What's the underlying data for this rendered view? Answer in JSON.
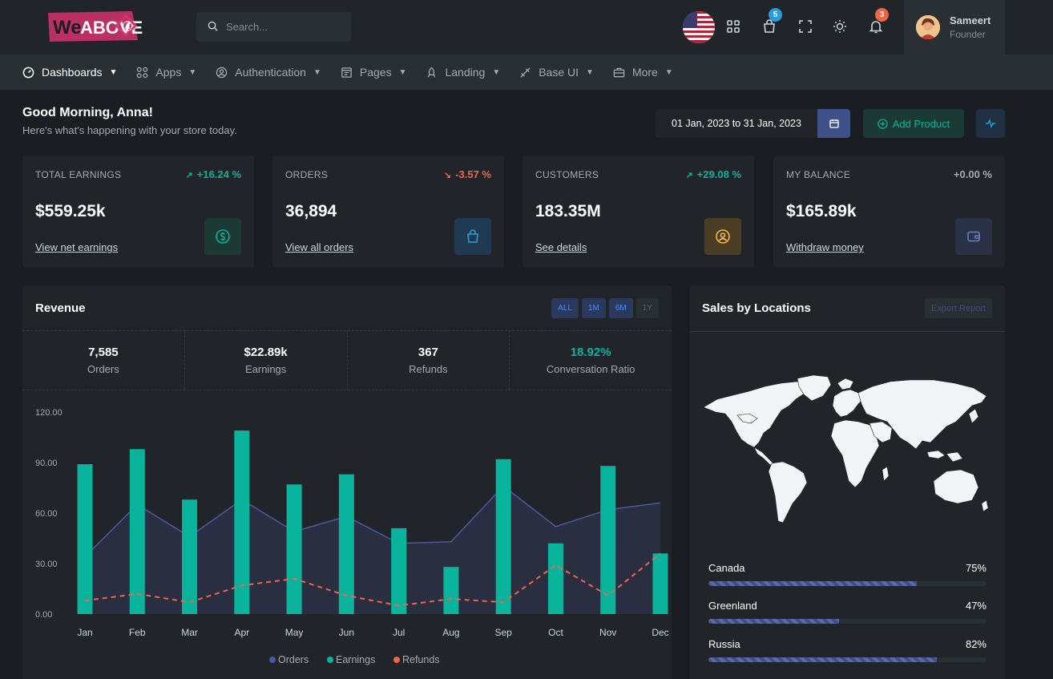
{
  "brand": {
    "logo_text": "WeABOVE"
  },
  "search": {
    "placeholder": "Search..."
  },
  "header": {
    "cart_badge": "5",
    "notification_badge": "3",
    "user": {
      "name": "Sameert",
      "role": "Founder"
    }
  },
  "nav": [
    {
      "label": "Dashboards",
      "icon": "dashboard-icon"
    },
    {
      "label": "Apps",
      "icon": "apps-icon"
    },
    {
      "label": "Authentication",
      "icon": "user-circle-icon"
    },
    {
      "label": "Pages",
      "icon": "pages-icon"
    },
    {
      "label": "Landing",
      "icon": "rocket-icon"
    },
    {
      "label": "Base UI",
      "icon": "pencil-ruler-icon"
    },
    {
      "label": "More",
      "icon": "briefcase-icon"
    }
  ],
  "greeting": {
    "title": "Good Morning, Anna!",
    "subtitle": "Here's what's happening with your store today."
  },
  "toolbar": {
    "date_range": "01 Jan, 2023 to 31 Jan, 2023",
    "add_product": "Add Product"
  },
  "kpis": [
    {
      "label": "TOTAL EARNINGS",
      "change": "+16.24 %",
      "trend": "up",
      "value": "$559.25k",
      "link": "View net earnings",
      "icon": "dollar-circle-icon"
    },
    {
      "label": "ORDERS",
      "change": "-3.57 %",
      "trend": "down",
      "value": "36,894",
      "link": "View all orders",
      "icon": "shopping-bag-icon"
    },
    {
      "label": "CUSTOMERS",
      "change": "+29.08 %",
      "trend": "up",
      "value": "183.35M",
      "link": "See details",
      "icon": "user-circle-icon"
    },
    {
      "label": "MY BALANCE",
      "change": "+0.00 %",
      "trend": "flat",
      "value": "$165.89k",
      "link": "Withdraw money",
      "icon": "wallet-icon"
    }
  ],
  "colors": {
    "accent": "#405189",
    "success": "#0ab39c",
    "danger": "#f06548",
    "warning": "#f7b84b",
    "info": "#299cdb"
  },
  "revenue": {
    "title": "Revenue",
    "filters": [
      "ALL",
      "1M",
      "6M",
      "1Y"
    ],
    "stats": [
      {
        "value": "7,585",
        "label": "Orders"
      },
      {
        "value": "$22.89k",
        "label": "Earnings"
      },
      {
        "value": "367",
        "label": "Refunds"
      },
      {
        "value": "18.92%",
        "label": "Conversation Ratio"
      }
    ]
  },
  "chart_data": {
    "type": "bar",
    "categories": [
      "Jan",
      "Feb",
      "Mar",
      "Apr",
      "May",
      "Jun",
      "Jul",
      "Aug",
      "Sep",
      "Oct",
      "Nov",
      "Dec"
    ],
    "ylim": [
      0,
      120
    ],
    "yticks": [
      "0.00",
      "30.00",
      "60.00",
      "90.00",
      "120.00"
    ],
    "series": [
      {
        "name": "Orders",
        "kind": "area",
        "color": "#405189",
        "values": [
          34,
          65,
          46,
          68,
          49,
          58,
          42,
          43,
          76,
          52,
          62,
          66
        ]
      },
      {
        "name": "Earnings",
        "kind": "bar",
        "color": "#0ab39c",
        "values": [
          89,
          98,
          68,
          109,
          77,
          83,
          51,
          28,
          92,
          42,
          88,
          36
        ]
      },
      {
        "name": "Refunds",
        "kind": "line-dashed",
        "color": "#f06548",
        "values": [
          8,
          12,
          7,
          17,
          21,
          11,
          5,
          9,
          7,
          29,
          11,
          36
        ]
      }
    ]
  },
  "sales": {
    "title": "Sales by Locations",
    "export": "Export Report",
    "locations": [
      {
        "name": "Canada",
        "percent": "75%",
        "value": 0.75
      },
      {
        "name": "Greenland",
        "percent": "47%",
        "value": 0.47
      },
      {
        "name": "Russia",
        "percent": "82%",
        "value": 0.82
      }
    ]
  }
}
